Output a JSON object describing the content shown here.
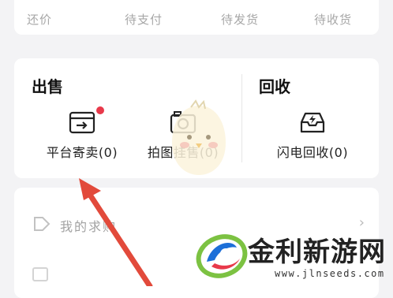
{
  "orders": {
    "tabs": [
      {
        "label": "还价"
      },
      {
        "label": "待支付"
      },
      {
        "label": "待发货"
      },
      {
        "label": "待收货"
      }
    ]
  },
  "sell": {
    "title": "出售",
    "items": [
      {
        "label": "平台寄卖(0)",
        "icon": "box-arrow-icon",
        "has_badge": true
      },
      {
        "label": "拍图挂售(0)",
        "icon": "camera-icon",
        "has_badge": false
      }
    ]
  },
  "recycle": {
    "title": "回收",
    "items": [
      {
        "label": "闪电回收(0)",
        "icon": "lightning-tray-icon"
      }
    ]
  },
  "mine": {
    "label": "我的求购"
  },
  "watermark": {
    "title": "金利新游网",
    "url": "www.jlnseeds.com"
  },
  "colors": {
    "badge": "#e8394a",
    "arrow": "#e24a3b",
    "logo_green": "#7cc242",
    "logo_blue": "#1d6fd8",
    "logo_red": "#e8394a"
  }
}
